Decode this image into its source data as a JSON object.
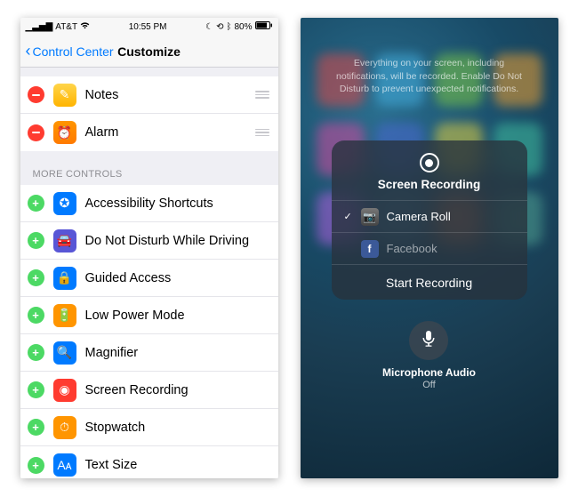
{
  "left": {
    "status": {
      "carrier": "AT&T",
      "time": "10:55 PM",
      "battery": "80%"
    },
    "nav": {
      "back": "Control Center",
      "title": "Customize"
    },
    "included": [
      {
        "label": "Notes",
        "iconClass": "ic-notes",
        "glyph": "✎",
        "name": "row-notes"
      },
      {
        "label": "Alarm",
        "iconClass": "ic-alarm",
        "glyph": "⏰",
        "name": "row-alarm"
      }
    ],
    "moreHeader": "MORE CONTROLS",
    "more": [
      {
        "label": "Accessibility Shortcuts",
        "iconClass": "ic-acc",
        "glyph": "✪",
        "name": "row-accessibility-shortcuts"
      },
      {
        "label": "Do Not Disturb While Driving",
        "iconClass": "ic-dnd",
        "glyph": "🚘",
        "name": "row-dnd-driving"
      },
      {
        "label": "Guided Access",
        "iconClass": "ic-guided",
        "glyph": "🔒",
        "name": "row-guided-access"
      },
      {
        "label": "Low Power Mode",
        "iconClass": "ic-low",
        "glyph": "🔋",
        "name": "row-low-power"
      },
      {
        "label": "Magnifier",
        "iconClass": "ic-mag",
        "glyph": "🔍",
        "name": "row-magnifier"
      },
      {
        "label": "Screen Recording",
        "iconClass": "ic-rec",
        "glyph": "◉",
        "name": "row-screen-recording"
      },
      {
        "label": "Stopwatch",
        "iconClass": "ic-stop",
        "glyph": "⏱",
        "name": "row-stopwatch"
      },
      {
        "label": "Text Size",
        "iconClass": "ic-text",
        "glyph": "Aᴀ",
        "name": "row-text-size"
      }
    ]
  },
  "right": {
    "hint": "Everything on your screen, including notifications, will be recorded. Enable Do Not Disturb to prevent unexpected notifications.",
    "panel": {
      "title": "Screen Recording",
      "destinations": [
        {
          "label": "Camera Roll",
          "selected": true,
          "iconClass": "ic-cam",
          "glyph": "📷",
          "name": "dest-camera-roll"
        },
        {
          "label": "Facebook",
          "selected": false,
          "iconClass": "ic-fb",
          "glyph": "f",
          "name": "dest-facebook"
        }
      ],
      "start": "Start Recording"
    },
    "mic": {
      "label": "Microphone Audio",
      "state": "Off"
    },
    "bgApps": [
      "#e04848",
      "#45b0e0",
      "#7cc845",
      "#f0a030",
      "#d24aa0",
      "#4a68d2",
      "#e0d040",
      "#40c0a0",
      "#b060e0",
      "#5080a0",
      "#e08050",
      "#50a090"
    ]
  }
}
